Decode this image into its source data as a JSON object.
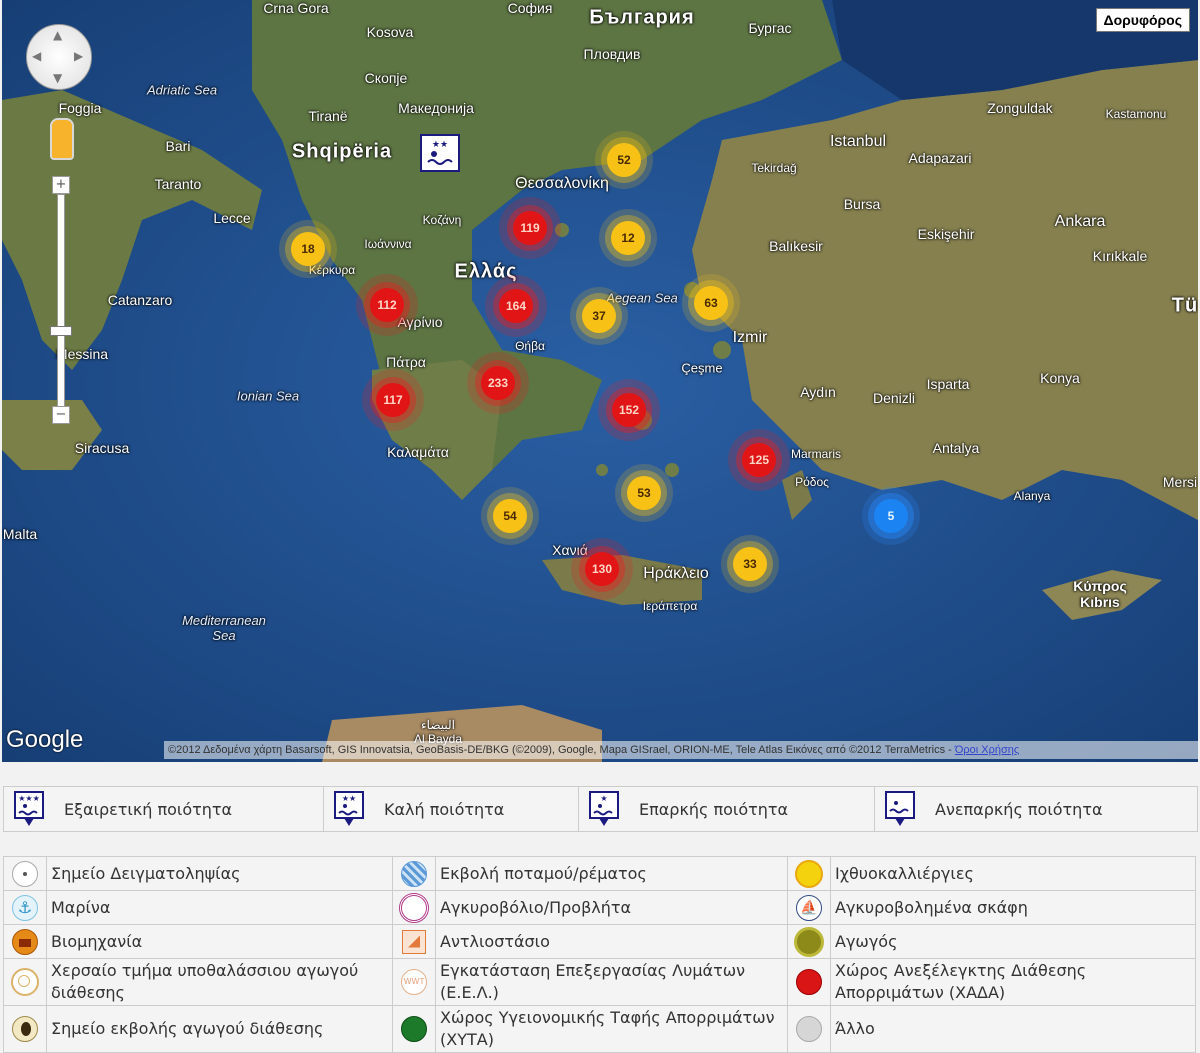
{
  "map": {
    "satellite_button": "Δορυφόρος",
    "attribution": "©2012 Δεδομένα χάρτη Basarsoft, GIS Innovatsia, GeoBasis-DE/BKG (©2009), Google, Mapa GISrael, ORION-ME, Tele Atlas Εικόνες από ©2012 TerraMetrics - ",
    "terms_link": "Όροι Χρήσης",
    "logo": "Google",
    "labels": {
      "shqiperia": "Shqipëria",
      "bulgaria": "България",
      "ellas": "Ελλάς",
      "adriatic": "Adriatic Sea",
      "ionian": "Ionian Sea",
      "aegean": "Aegean Sea",
      "mediterranean": "Mediterranean\nSea",
      "crna_gora": "Crna Gora",
      "kosova": "Kosova",
      "sofia": "София",
      "skopje": "Скопје",
      "makedonija": "Македонија",
      "tirane": "Tiranë",
      "plovdiv": "Пловдив",
      "burgas": "Бургас",
      "thessaloniki": "Θεσσαλονίκη",
      "istanbul": "Istanbul",
      "ankara": "Ankara",
      "izmir": "Izmir",
      "bursa": "Bursa",
      "konya": "Konya",
      "antalya": "Antalya",
      "patra": "Πάτρα",
      "kalamata": "Καλαμάτα",
      "iraklio": "Ηράκλειο",
      "chania": "Χανιά",
      "rodos": "Ρόδος",
      "kypros": "Κύπρος\nKıbrıs",
      "messina": "Messina",
      "catanzaro": "Catanzaro",
      "bari": "Bari",
      "foggia": "Foggia",
      "taranto": "Taranto",
      "lecce": "Lecce",
      "malta": "Malta",
      "siracusa": "Siracusa",
      "zonguldak": "Zonguldak",
      "kastamonu": "Kastamonu",
      "adapazari": "Adapazari",
      "eskisehir": "Eskişehir",
      "balikesir": "Balıkesir",
      "kirikkale": "Kırıkkale",
      "isparta": "Isparta",
      "denizli": "Denizli",
      "aydin": "Aydın",
      "marmaris": "Marmaris",
      "alanya": "Alanya",
      "mersin": "Mersi",
      "tekirdag": "Tekirdağ",
      "cesme": "Çeşme",
      "agrinio": "Αγρίνιο",
      "kerkyra": "Κέρκυρα",
      "ioannina": "Ιωάννινα",
      "kozani": "Κοζάνη",
      "thiva": "Θήβα",
      "ierapetra": "Ιεράπετρα",
      "tu": "Tü",
      "bayda": "البيضاء\nAl Bayda"
    },
    "clusters": [
      {
        "count": "52",
        "color": "yellow"
      },
      {
        "count": "119",
        "color": "red"
      },
      {
        "count": "12",
        "color": "yellow"
      },
      {
        "count": "18",
        "color": "yellow"
      },
      {
        "count": "112",
        "color": "red"
      },
      {
        "count": "164",
        "color": "red"
      },
      {
        "count": "37",
        "color": "yellow"
      },
      {
        "count": "63",
        "color": "yellow"
      },
      {
        "count": "233",
        "color": "red"
      },
      {
        "count": "117",
        "color": "red"
      },
      {
        "count": "152",
        "color": "red"
      },
      {
        "count": "125",
        "color": "red"
      },
      {
        "count": "53",
        "color": "yellow"
      },
      {
        "count": "54",
        "color": "yellow"
      },
      {
        "count": "5",
        "color": "blue"
      },
      {
        "count": "33",
        "color": "yellow"
      },
      {
        "count": "130",
        "color": "red"
      }
    ]
  },
  "quality_legend": [
    {
      "label": "Εξαιρετική ποιότητα",
      "stars": "★★★"
    },
    {
      "label": "Καλή ποιότητα",
      "stars": "★★"
    },
    {
      "label": "Επαρκής ποιότητα",
      "stars": "★"
    },
    {
      "label": "Ανεπαρκής ποιότητα",
      "stars": ""
    }
  ],
  "legend": [
    [
      "Σημείο Δειγματοληψίας",
      "Εκβολή ποταμού/ρέματος",
      "Ιχθυοκαλλιέργιες"
    ],
    [
      "Μαρίνα",
      "Αγκυροβόλιο/Προβλήτα",
      "Αγκυροβολημένα σκάφη"
    ],
    [
      "Βιομηχανία",
      "Αντλιοστάσιο",
      "Αγωγός"
    ],
    [
      "Χερσαίο τμήμα υποθαλάσσιου αγωγού διάθεσης",
      "Εγκατάσταση Επεξεργασίας Λυμάτων (Ε.Ε.Λ.)",
      "Χώρος Ανεξέλεγκτης Διάθεσης Απορριμάτων (ΧΑΔΑ)"
    ],
    [
      "Σημείο εκβολής αγωγού διάθεσης",
      "Χώρος Υγειονομικής Ταφής Απορριμάτων (ΧΥΤΑ)",
      "Άλλο"
    ]
  ],
  "legend_icon_labels": {
    "wwt": "WWT"
  }
}
